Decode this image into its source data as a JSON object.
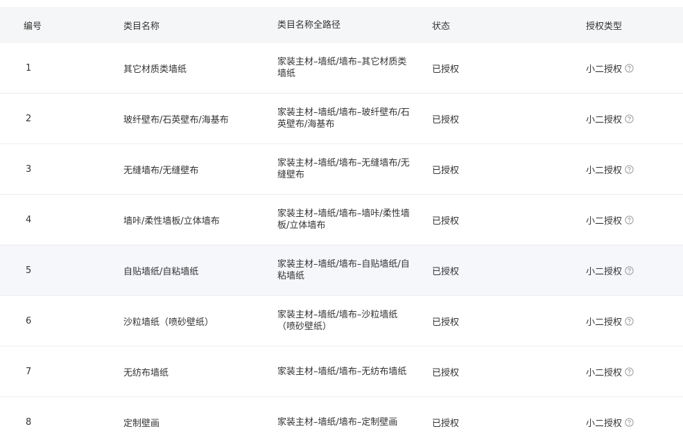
{
  "table": {
    "headers": {
      "number": "编号",
      "category_name": "类目名称",
      "full_path": "类目名称全路径",
      "status": "状态",
      "auth_type": "授权类型"
    },
    "rows": [
      {
        "number": "1",
        "name": "其它材质类墙纸",
        "path": "家装主材–墙纸/墙布–其它材质类墙纸",
        "status": "已授权",
        "auth_type": "小二授权"
      },
      {
        "number": "2",
        "name": "玻纤壁布/石英壁布/海基布",
        "path": "家装主材–墙纸/墙布–玻纤壁布/石英壁布/海基布",
        "status": "已授权",
        "auth_type": "小二授权"
      },
      {
        "number": "3",
        "name": "无缝墙布/无缝壁布",
        "path": "家装主材–墙纸/墙布–无缝墙布/无缝壁布",
        "status": "已授权",
        "auth_type": "小二授权"
      },
      {
        "number": "4",
        "name": "墙咔/柔性墙板/立体墙布",
        "path": "家装主材–墙纸/墙布–墙咔/柔性墙板/立体墙布",
        "status": "已授权",
        "auth_type": "小二授权"
      },
      {
        "number": "5",
        "name": "自贴墙纸/自粘墙纸",
        "path": "家装主材–墙纸/墙布–自贴墙纸/自粘墙纸",
        "status": "已授权",
        "auth_type": "小二授权"
      },
      {
        "number": "6",
        "name": "沙粒墙纸（喷砂壁纸）",
        "path": "家装主材–墙纸/墙布–沙粒墙纸（喷砂壁纸）",
        "status": "已授权",
        "auth_type": "小二授权"
      },
      {
        "number": "7",
        "name": "无纺布墙纸",
        "path": "家装主材–墙纸/墙布–无纺布墙纸",
        "status": "已授权",
        "auth_type": "小二授权"
      },
      {
        "number": "8",
        "name": "定制壁画",
        "path": "家装主材–墙纸/墙布–定制壁画",
        "status": "已授权",
        "auth_type": "小二授权"
      }
    ],
    "help_icon": "question-circle-icon",
    "hover_row_index": 4,
    "colors": {
      "header_bg": "#f5f6f7",
      "hover_bg": "#f5f7fa",
      "border": "#eeeeee",
      "text": "#333333",
      "icon": "#999999"
    }
  }
}
